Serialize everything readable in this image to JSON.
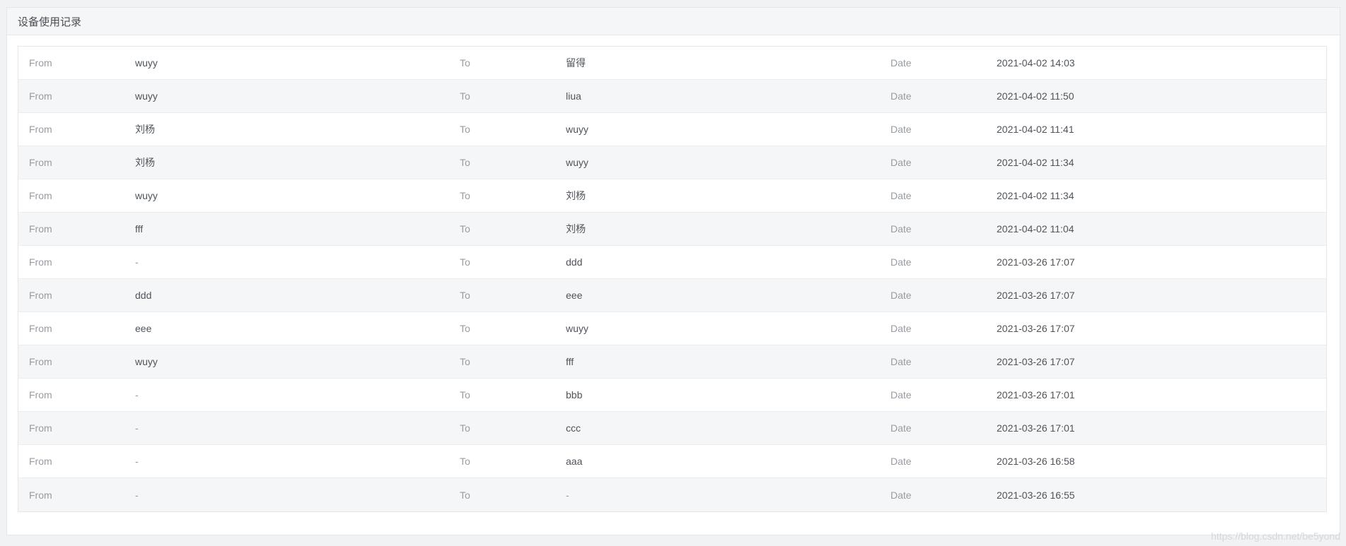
{
  "panel": {
    "title": "设备使用记录"
  },
  "labels": {
    "from": "From",
    "to": "To",
    "date": "Date"
  },
  "records": [
    {
      "from": "wuyy",
      "to": "留得",
      "date": "2021-04-02 14:03"
    },
    {
      "from": "wuyy",
      "to": "liua",
      "date": "2021-04-02 11:50"
    },
    {
      "from": "刘杨",
      "to": "wuyy",
      "date": "2021-04-02 11:41"
    },
    {
      "from": "刘杨",
      "to": "wuyy",
      "date": "2021-04-02 11:34"
    },
    {
      "from": "wuyy",
      "to": "刘杨",
      "date": "2021-04-02 11:34"
    },
    {
      "from": "fff",
      "to": "刘杨",
      "date": "2021-04-02 11:04"
    },
    {
      "from": "-",
      "to": "ddd",
      "date": "2021-03-26 17:07"
    },
    {
      "from": "ddd",
      "to": "eee",
      "date": "2021-03-26 17:07"
    },
    {
      "from": "eee",
      "to": "wuyy",
      "date": "2021-03-26 17:07"
    },
    {
      "from": "wuyy",
      "to": "fff",
      "date": "2021-03-26 17:07"
    },
    {
      "from": "-",
      "to": "bbb",
      "date": "2021-03-26 17:01"
    },
    {
      "from": "-",
      "to": "ccc",
      "date": "2021-03-26 17:01"
    },
    {
      "from": "-",
      "to": "aaa",
      "date": "2021-03-26 16:58"
    },
    {
      "from": "-",
      "to": "-",
      "date": "2021-03-26 16:55"
    }
  ],
  "watermark": "https://blog.csdn.net/be5yond"
}
